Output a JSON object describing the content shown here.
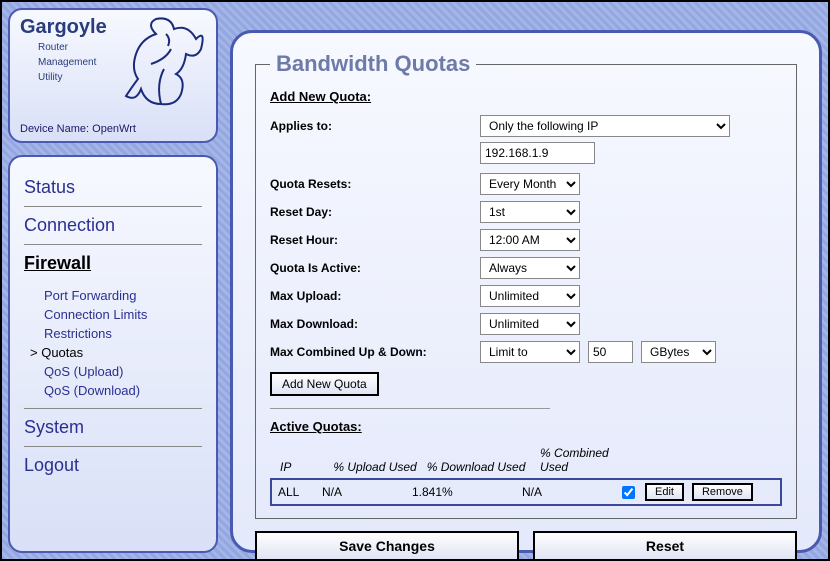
{
  "logo": {
    "title": "Gargoyle",
    "sub1": "Router",
    "sub2": "Management",
    "sub3": "Utility"
  },
  "device": {
    "prefix": "Device Name:",
    "name": "OpenWrt"
  },
  "nav": {
    "status": "Status",
    "connection": "Connection",
    "firewall": "Firewall",
    "system": "System",
    "logout": "Logout",
    "sub": {
      "pf": "Port Forwarding",
      "cl": "Connection Limits",
      "re": "Restrictions",
      "qu": "Quotas",
      "qup": "QoS (Upload)",
      "qdn": "QoS (Download)"
    }
  },
  "page": {
    "title": "Bandwidth Quotas",
    "add_hdr": "Add New Quota:",
    "labels": {
      "applies": "Applies to:",
      "resets": "Quota Resets:",
      "reset_day": "Reset Day:",
      "reset_hour": "Reset Hour:",
      "active": "Quota Is Active:",
      "max_up": "Max Upload:",
      "max_dn": "Max Download:",
      "max_comb": "Max Combined Up & Down:"
    },
    "values": {
      "applies": "Only the following IP",
      "ip": "192.168.1.9",
      "resets": "Every Month",
      "reset_day": "1st",
      "reset_hour": "12:00 AM",
      "active": "Always",
      "max_up": "Unlimited",
      "max_dn": "Unlimited",
      "max_comb": "Limit to",
      "comb_val": "50",
      "comb_unit": "GBytes"
    },
    "add_btn": "Add New Quota",
    "active_hdr": "Active Quotas:",
    "cols": {
      "ip": "IP",
      "up": "% Upload Used",
      "dn": "% Download Used",
      "cb": "% Combined Used"
    },
    "row": {
      "ip": "ALL",
      "up": "N/A",
      "dn": "1.841%",
      "cb": "N/A"
    },
    "edit": "Edit",
    "remove": "Remove",
    "save": "Save Changes",
    "reset": "Reset"
  }
}
